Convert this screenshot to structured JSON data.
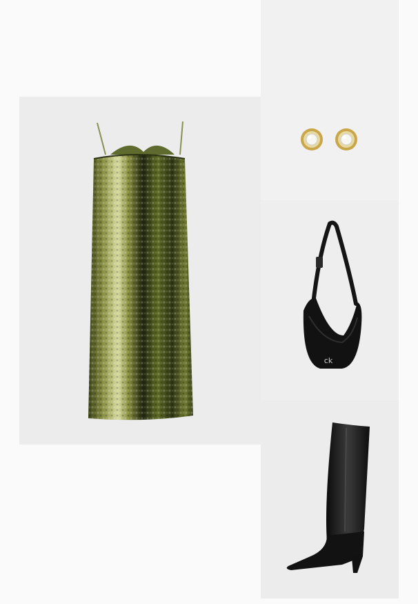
{
  "outfit": {
    "items": [
      {
        "kind": "dress",
        "icon": "sequin-dress-icon",
        "color": "#7f8a3a"
      },
      {
        "kind": "earrings",
        "icon": "stud-earrings-icon",
        "color": "#c9a64a"
      },
      {
        "kind": "bag",
        "icon": "crossbody-bag-icon",
        "color": "#121212"
      },
      {
        "kind": "boots",
        "icon": "knee-boot-icon",
        "color": "#151515"
      }
    ],
    "bag_logo": "ck"
  },
  "colors": {
    "page_bg": "#fafafa",
    "tile_bg": "#ececec",
    "sequin_green": "#7f8a3a",
    "gold": "#c9a64a",
    "leather": "#121212"
  }
}
